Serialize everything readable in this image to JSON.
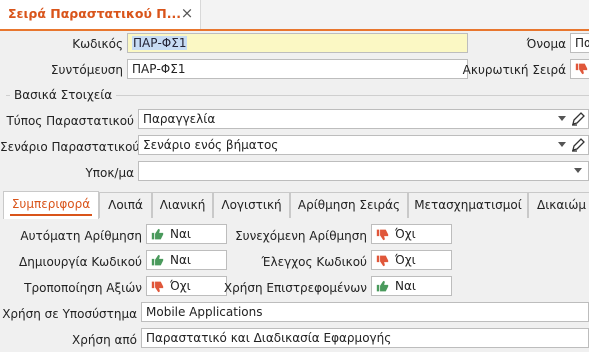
{
  "doc_tab": {
    "title": "Σειρά Παραστατικού Π...",
    "close": "×"
  },
  "header": {
    "code_label": "Κωδικός",
    "code_value": "ΠΑΡ-ΦΣ1",
    "name_label": "Όνομα",
    "name_value": "Πα",
    "short_label": "Συντόμευση",
    "short_value": "ΠΑΡ-ΦΣ1",
    "cancel_series_label": "Ακυρωτική Σειρά"
  },
  "basic_group": {
    "title": "Βασικά Στοιχεία",
    "doc_type_label": "Τύπος Παραστατικού",
    "doc_type_value": "Παραγγελία",
    "scenario_label": "Σενάριο Παραστατικού",
    "scenario_value": "Σενάριο ενός βήματος",
    "branch_label": "Υποκ/μα",
    "branch_value": ""
  },
  "tabs": [
    {
      "label": "Συμπεριφορά"
    },
    {
      "label": "Λοιπά"
    },
    {
      "label": "Λιανική"
    },
    {
      "label": "Λογιστική"
    },
    {
      "label": "Αρίθμηση Σειράς"
    },
    {
      "label": "Μετασχηματισμοί"
    },
    {
      "label": "Δικαιώμ"
    }
  ],
  "behavior": {
    "auto_num_label": "Αυτόματη Αρίθμηση",
    "auto_num_value": "Ναι",
    "cont_num_label": "Συνεχόμενη Αρίθμηση",
    "cont_num_value": "Όχι",
    "create_code_label": "Δημιουργία Κωδικού",
    "create_code_value": "Ναι",
    "check_code_label": "Έλεγχος Κωδικού",
    "check_code_value": "Όχι",
    "modify_values_label": "Τροποποίηση Αξιών",
    "modify_values_value": "Όχι",
    "use_returns_label": "Χρήση Επιστρεφομένων",
    "use_returns_value": "Ναι",
    "subsystem_label": "Χρήση σε Υποσύστημα",
    "subsystem_value": "Mobile Applications",
    "used_by_label": "Χρήση από",
    "used_by_value": "Παραστατικό και Διαδικασία Εφαρμογής"
  },
  "colors": {
    "accent": "#d9541a",
    "yes": "#4a9a5c",
    "no": "#e0573a"
  },
  "icons": {
    "yes": "thumbs-up-icon",
    "no": "thumbs-down-icon",
    "edit": "pencil-icon"
  }
}
